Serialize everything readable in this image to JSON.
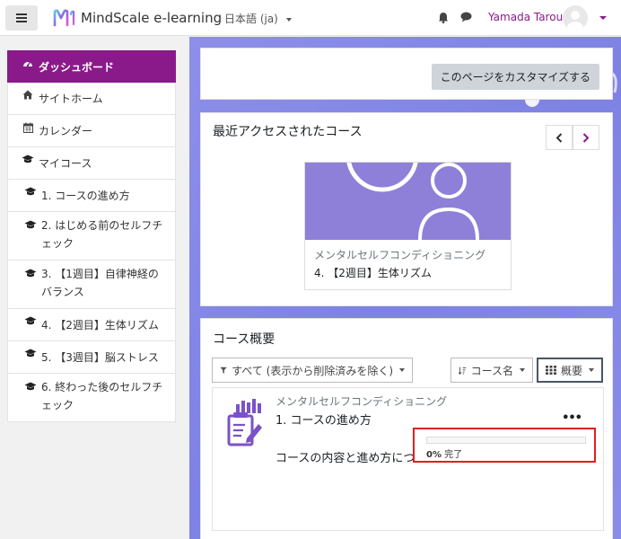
{
  "colors": {
    "brand": "#8a1a8a",
    "highlight_border": "#e01f1f",
    "main_bg": "#8d8fe8"
  },
  "navbar": {
    "menu_icon": "hamburger-icon",
    "site_name": "MindScale e-learning",
    "language": "日本語 (ja)",
    "notifications_icon": "bell-icon",
    "messages_icon": "chat-icon",
    "user_name": "Yamada Tarou"
  },
  "sidebar": {
    "items": [
      {
        "label": "ダッシュボード",
        "icon": "dashboard-icon",
        "active": true
      },
      {
        "label": "サイトホーム",
        "icon": "home-icon"
      },
      {
        "label": "カレンダー",
        "icon": "calendar-icon"
      },
      {
        "label": "マイコース",
        "icon": "graduation-cap-icon"
      },
      {
        "label": "1. コースの進め方",
        "icon": "graduation-cap-icon"
      },
      {
        "label": "2. はじめる前のセルフチェック",
        "icon": "graduation-cap-icon"
      },
      {
        "label": "3. 【1週目】自律神経のバランス",
        "icon": "graduation-cap-icon"
      },
      {
        "label": "4. 【2週目】生体リズム",
        "icon": "graduation-cap-icon"
      },
      {
        "label": "5. 【3週目】脳ストレス",
        "icon": "graduation-cap-icon"
      },
      {
        "label": "6. 終わった後のセルフチェック",
        "icon": "graduation-cap-icon"
      }
    ]
  },
  "main": {
    "customize_button": "このページをカスタマイズする",
    "recent": {
      "title": "最近アクセスされたコース",
      "prev_icon": "chevron-left-icon",
      "next_icon": "chevron-right-icon",
      "course_category": "メンタルセルフコンディショニング",
      "course_name": "4. 【2週目】生体リズム"
    },
    "overview": {
      "title": "コース概要",
      "filter_label": "すべて (表示から削除済みを除く)",
      "sort_label": "コース名",
      "view_label": "概要",
      "course": {
        "category": "メンタルセルフコンディショニング",
        "name": "1. コースの進め方",
        "summary": "コースの内容と進め方についての説明",
        "progress_percent": 0,
        "progress_value": "0%",
        "progress_suffix": " 完了",
        "menu_icon": "more-icon"
      }
    }
  }
}
